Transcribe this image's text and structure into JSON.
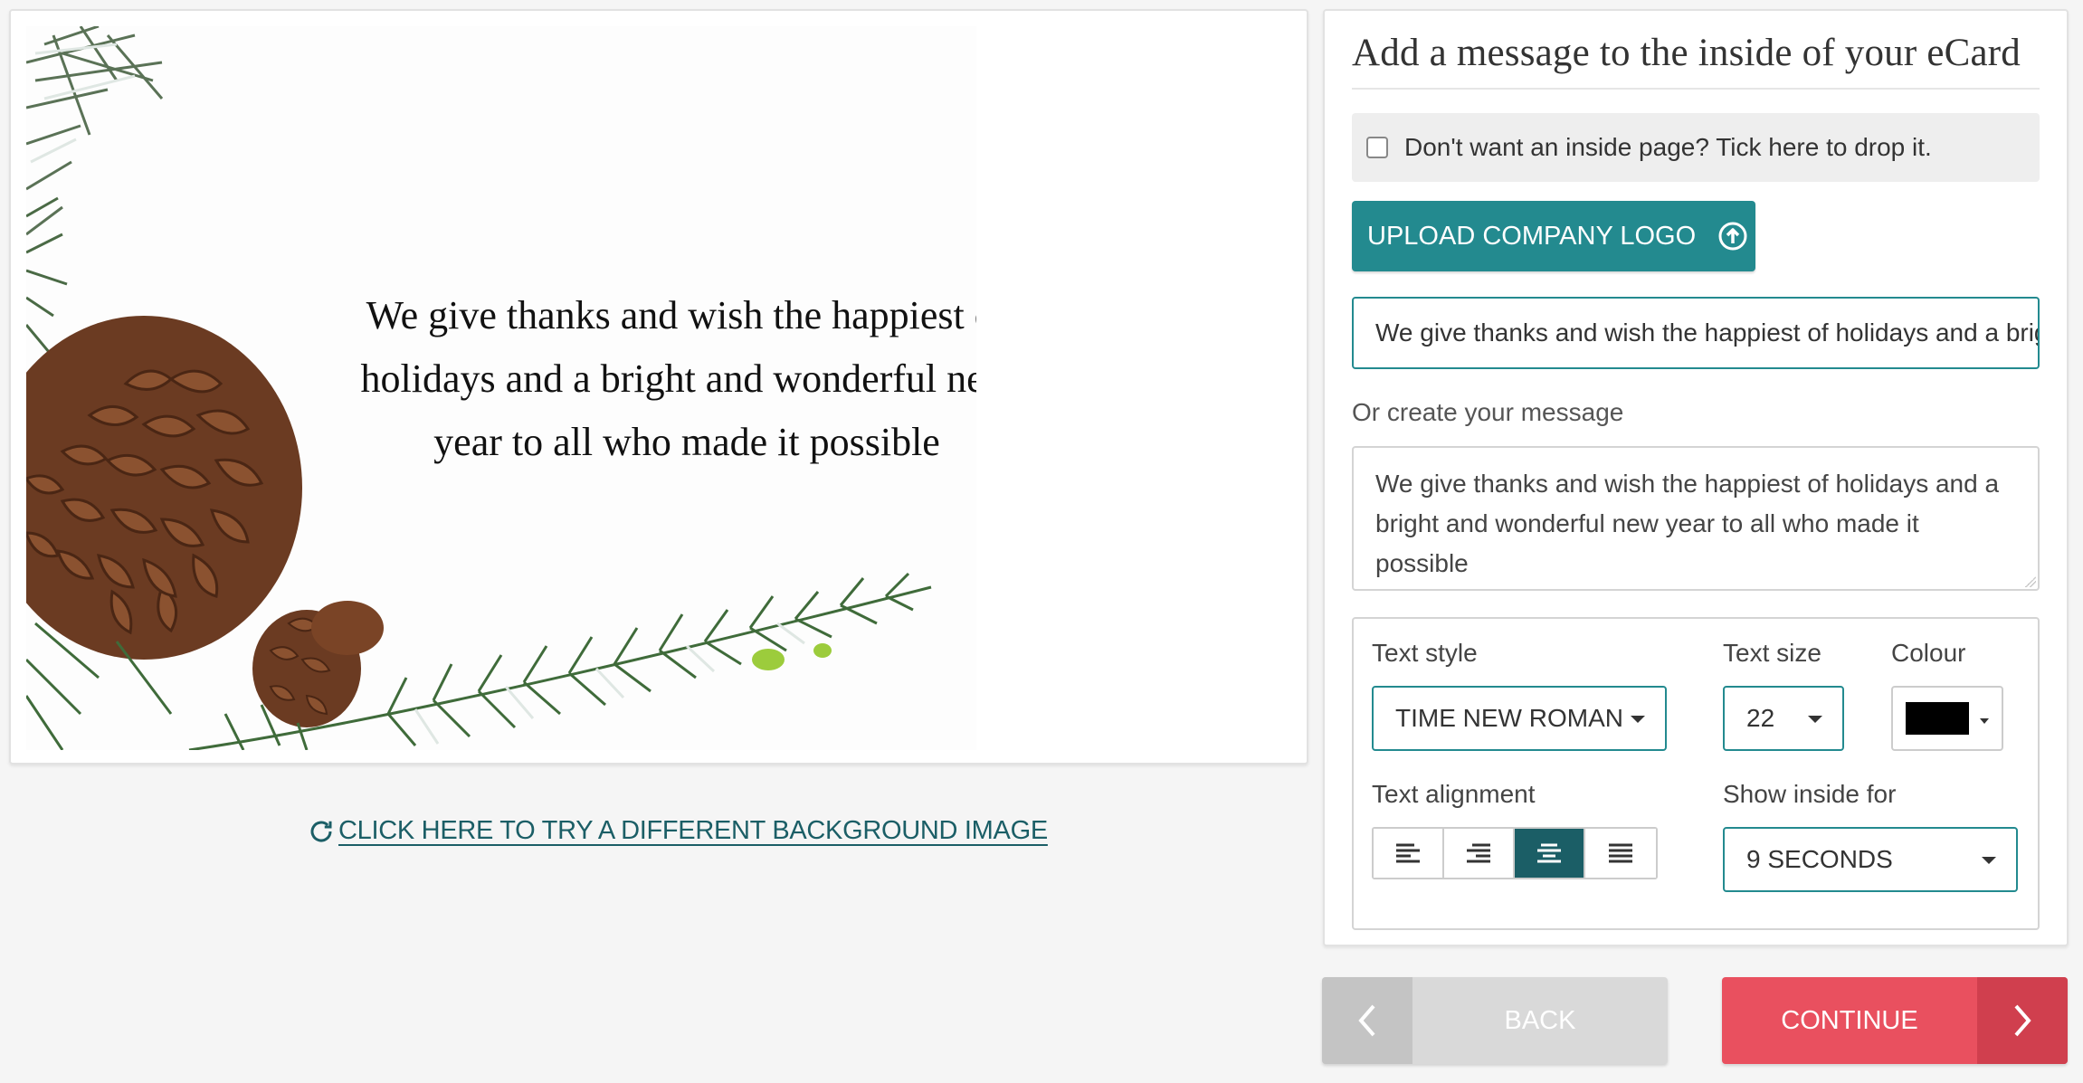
{
  "preview": {
    "card_message_lines": [
      "We give thanks and wish the happiest of",
      "holidays and a bright and wonderful new",
      "year to all who made it possible"
    ],
    "change_background_label": "CLICK HERE TO TRY A DIFFERENT BACKGROUND IMAGE",
    "background_image": "pine-cone-branches"
  },
  "editor": {
    "title": "Add a message to the inside of your eCard",
    "drop_inside_label": "Don't want an inside page? Tick here to drop it.",
    "drop_inside_checked": false,
    "upload_logo_label": "UPLOAD COMPANY LOGO",
    "message_select_value": "We give thanks and wish the happiest of holidays and a bright and wonderful new year to all who made it possible",
    "custom_message_label": "Or create your message",
    "custom_message_value": "We give thanks and wish the happiest of holidays and a bright and wonderful new year to all who made it possible",
    "text_style_label": "Text style",
    "text_style_value": "TIME NEW ROMAN",
    "text_size_label": "Text size",
    "text_size_value": "22",
    "colour_label": "Colour",
    "colour_value": "#000000",
    "text_alignment_label": "Text alignment",
    "alignment_options": [
      "left",
      "right",
      "center",
      "justify"
    ],
    "alignment_selected": "center",
    "show_inside_label": "Show inside for",
    "show_inside_value": "9 SECONDS"
  },
  "nav": {
    "back_label": "BACK",
    "continue_label": "CONTINUE"
  },
  "colors": {
    "accent": "#238a8f",
    "accent_dark": "#1b5e66",
    "continue": "#e9505f",
    "back": "#d9d9d9"
  }
}
